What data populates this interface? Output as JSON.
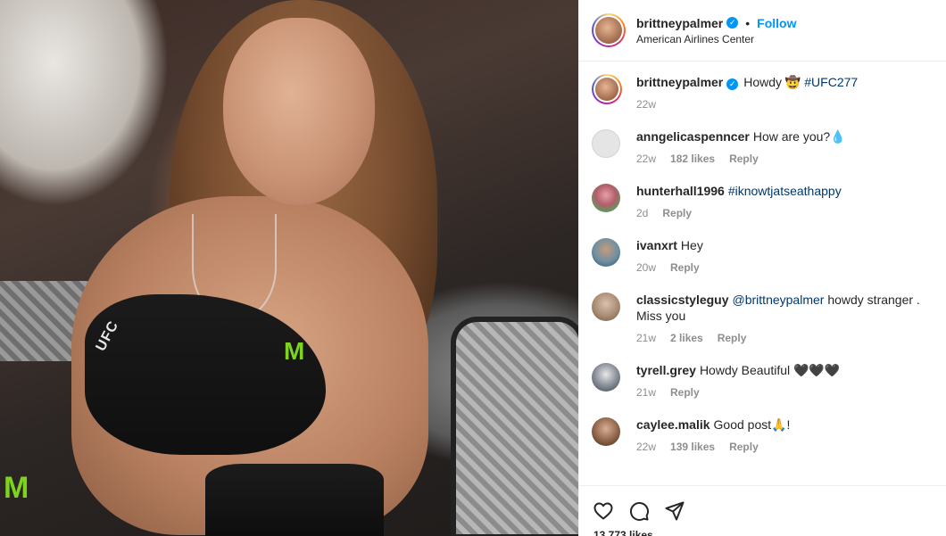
{
  "header": {
    "username": "brittneypalmer",
    "separator": "•",
    "follow_label": "Follow",
    "location": "American Airlines Center"
  },
  "caption": {
    "username": "brittneypalmer",
    "text": "Howdy 🤠",
    "hashtag": "#UFC277",
    "time": "22w"
  },
  "comments": [
    {
      "username": "anngelicaspenncer",
      "text": "How are you?💧",
      "time": "22w",
      "likes": "182 likes",
      "reply": "Reply",
      "avatar_color": "#dbdbdb"
    },
    {
      "username": "hunterhall1996",
      "link": "#iknowtjatseathappy",
      "time": "2d",
      "reply": "Reply",
      "avatar_color": "#6aa86a"
    },
    {
      "username": "ivanxrt",
      "text": "Hey",
      "time": "20w",
      "reply": "Reply",
      "avatar_color": "#3f6f8a"
    },
    {
      "username": "classicstyleguy",
      "mention": "@brittneypalmer",
      "text": "howdy stranger . Miss you",
      "time": "21w",
      "likes": "2 likes",
      "reply": "Reply",
      "avatar_color": "#b9a08a"
    },
    {
      "username": "tyrell.grey",
      "text": "Howdy Beautiful 🖤🖤🖤",
      "time": "21w",
      "reply": "Reply",
      "avatar_color": "#4d5663"
    },
    {
      "username": "caylee.malik",
      "text": "Good post🙏!",
      "time": "22w",
      "likes": "139 likes",
      "reply": "Reply",
      "avatar_color": "#7a5a44"
    }
  ],
  "photo": {
    "top_label": "UFC",
    "brand_mark": "M"
  },
  "actions": {
    "like_icon": "heart-icon",
    "comment_icon": "comment-icon",
    "share_icon": "paper-plane-icon"
  },
  "likes_peek": "13,773 likes",
  "colors": {
    "accent": "#0095f6",
    "text": "#262626",
    "muted": "#8e8e8e"
  }
}
